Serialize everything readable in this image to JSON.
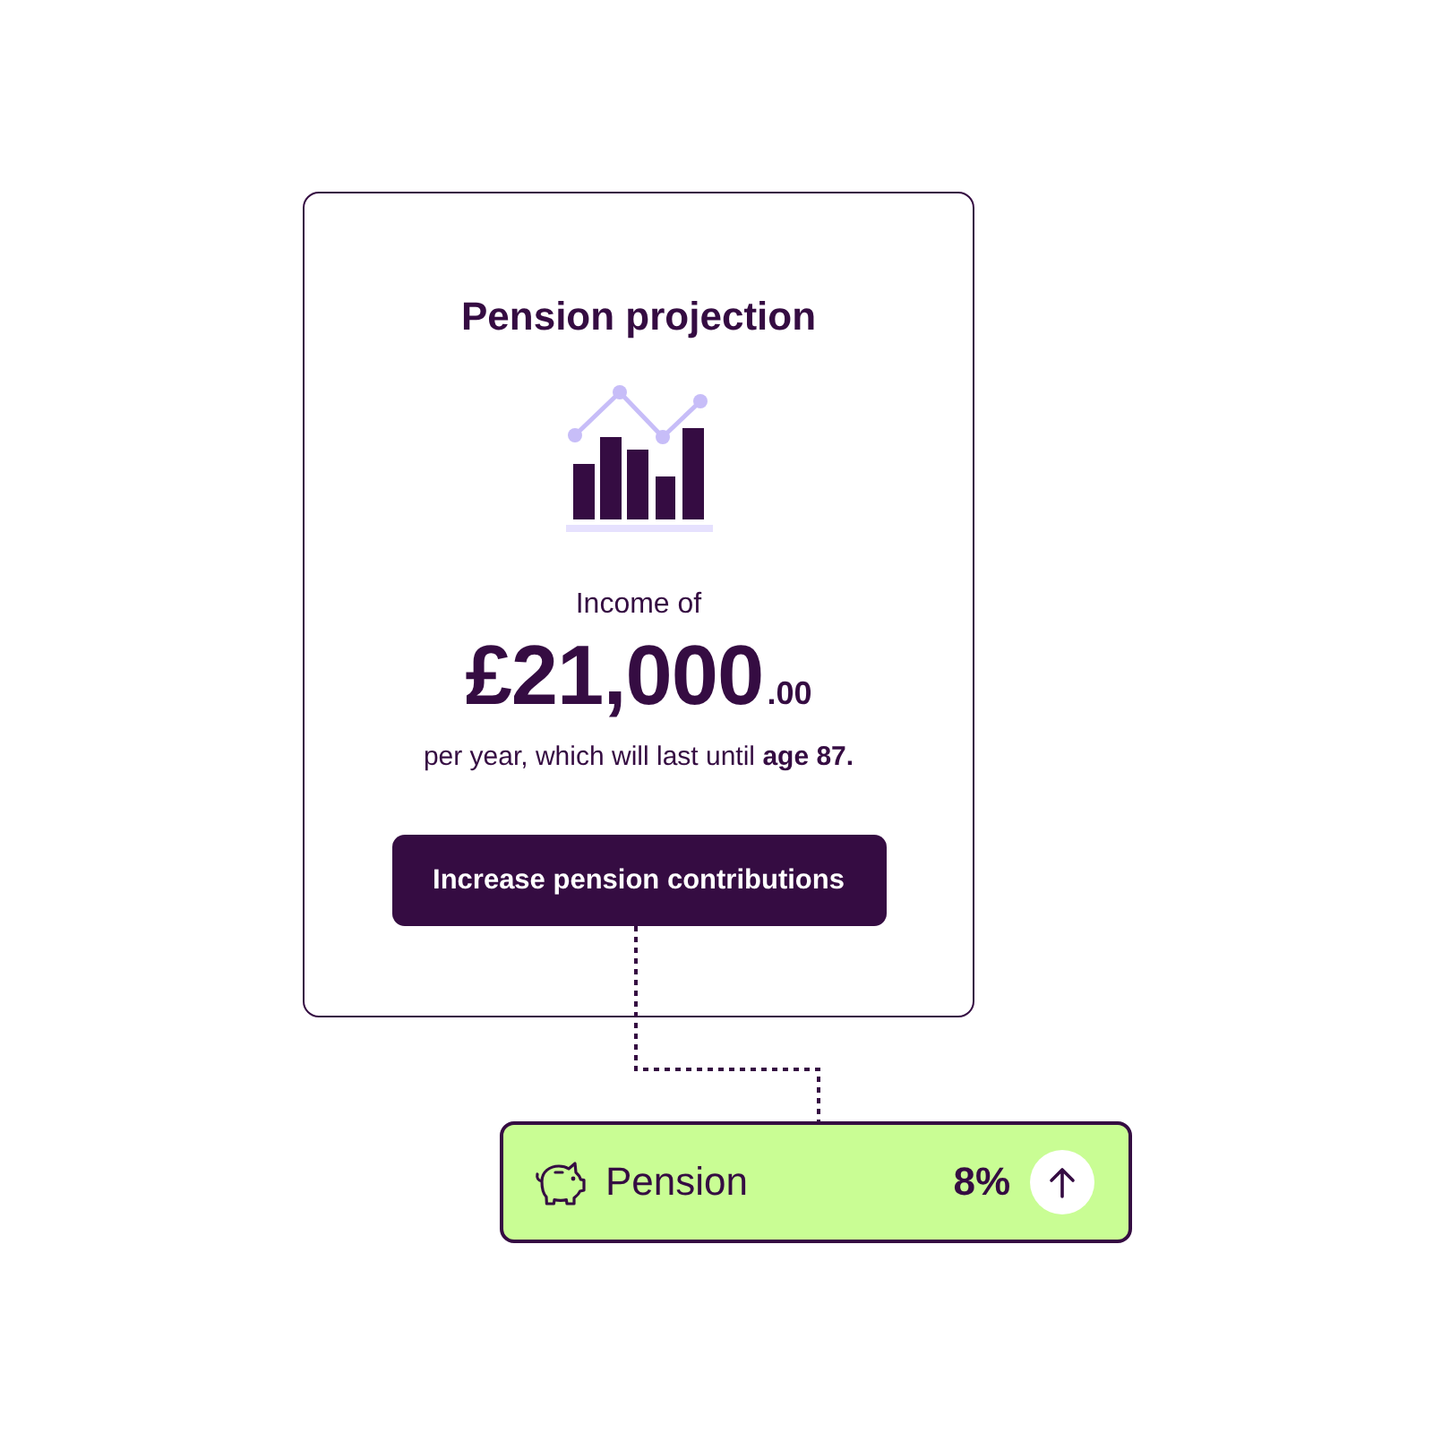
{
  "card": {
    "title": "Pension projection",
    "income_label": "Income of",
    "amount": "£21,000",
    "amount_decimals": ".00",
    "duration_text": "per year, which will last until **age 87.**",
    "button": "Increase pension contributions"
  },
  "contribution": {
    "label": "Pension",
    "value": "8%"
  }
}
